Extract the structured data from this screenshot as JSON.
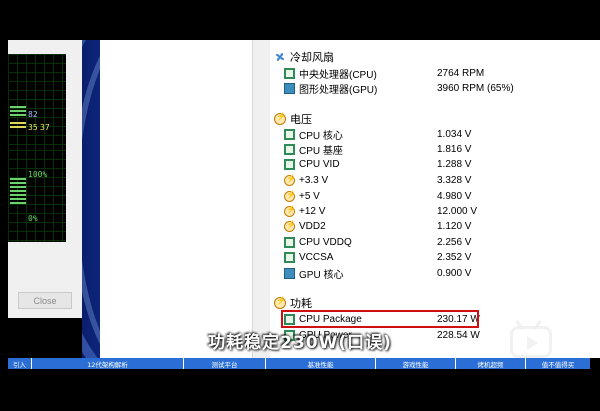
{
  "left_window": {
    "monitor1": {
      "value_a": "82",
      "value_b": "35",
      "value_c": "37"
    },
    "monitor2": {
      "top_label": "100%",
      "bottom_label": "0%"
    },
    "close_label": "Close"
  },
  "sensors": {
    "fans": {
      "header": "冷却风扇",
      "rows": [
        {
          "label": "中央处理器(CPU)",
          "value": "2764 RPM"
        },
        {
          "label": "图形处理器(GPU)",
          "value": "3960 RPM  (65%)"
        }
      ]
    },
    "voltage": {
      "header": "电压",
      "rows": [
        {
          "label": "CPU 核心",
          "value": "1.034 V",
          "icon": "chip"
        },
        {
          "label": "CPU 基座",
          "value": "1.816 V",
          "icon": "chip"
        },
        {
          "label": "CPU VID",
          "value": "1.288 V",
          "icon": "chip"
        },
        {
          "label": "+3.3 V",
          "value": "3.328 V",
          "icon": "bolt"
        },
        {
          "label": "+5 V",
          "value": "4.980 V",
          "icon": "bolt"
        },
        {
          "label": "+12 V",
          "value": "12.000 V",
          "icon": "bolt"
        },
        {
          "label": "VDD2",
          "value": "1.120 V",
          "icon": "bolt"
        },
        {
          "label": "CPU VDDQ",
          "value": "2.256 V",
          "icon": "chip"
        },
        {
          "label": "VCCSA",
          "value": "2.352 V",
          "icon": "chip"
        },
        {
          "label": "GPU 核心",
          "value": "0.900 V",
          "icon": "gpu"
        }
      ]
    },
    "power": {
      "header": "功耗",
      "rows": [
        {
          "label": "CPU Package",
          "value": "230.17 W"
        },
        {
          "label": "GPU Power",
          "value": "228.54 W"
        }
      ]
    }
  },
  "subtitle": "功耗稳定230W(口误)",
  "chapters": [
    "引入",
    "12代架构解析",
    "测试平台",
    "基准性能",
    "游戏性能",
    "烤机超频",
    "值不值得买"
  ],
  "colors": {
    "highlight": "#d01010",
    "chapter_bar": "#2b6fd6"
  }
}
